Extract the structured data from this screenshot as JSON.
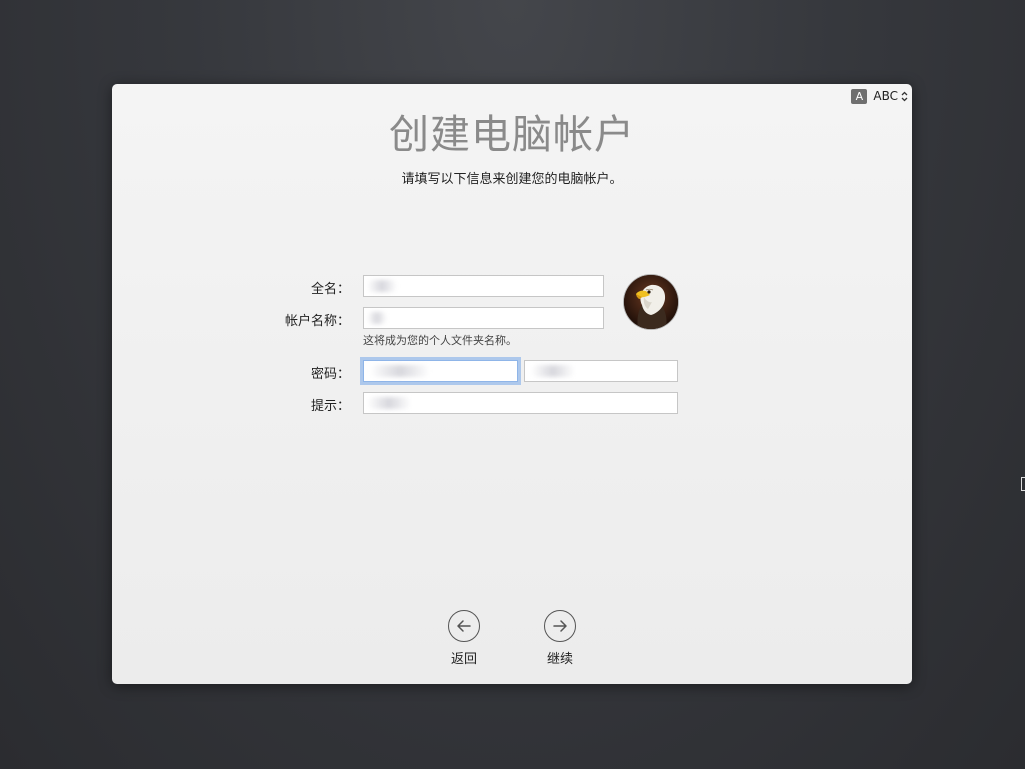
{
  "input_source": {
    "badge": "A",
    "label": "ABC"
  },
  "header": {
    "title": "创建电脑帐户",
    "subtitle": "请填写以下信息来创建您的电脑帐户。"
  },
  "form": {
    "full_name": {
      "label": "全名：",
      "value": ""
    },
    "account_name": {
      "label": "帐户名称：",
      "value": "",
      "note": "这将成为您的个人文件夹名称。"
    },
    "password": {
      "label": "密码：",
      "value": "",
      "verify_value": ""
    },
    "hint": {
      "label": "提示：",
      "value": ""
    }
  },
  "avatar": {
    "icon": "eagle-avatar-icon"
  },
  "nav": {
    "back_label": "返回",
    "continue_label": "继续"
  },
  "colors": {
    "background": "#36383d",
    "panel": "#f0f0f0",
    "title": "#8a8a8a",
    "focus": "#5a96e6"
  }
}
